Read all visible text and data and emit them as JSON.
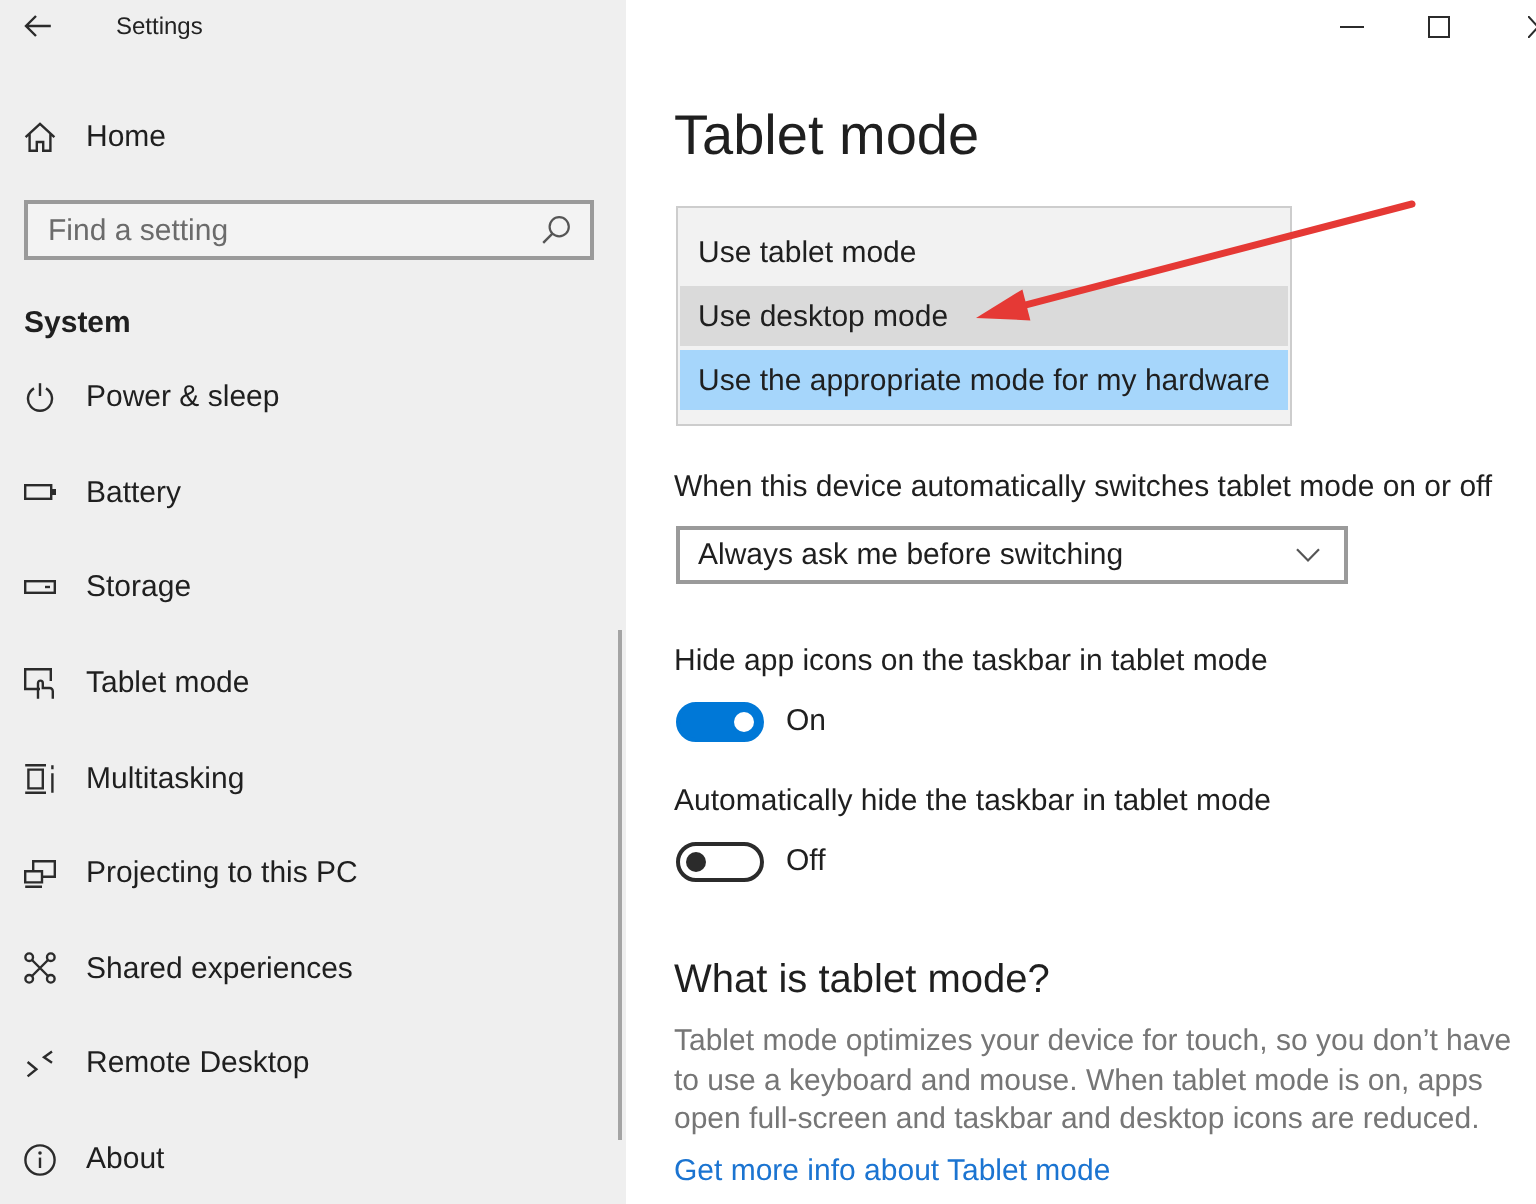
{
  "window": {
    "title": "Settings"
  },
  "sidebar": {
    "home": "Home",
    "search": {
      "placeholder": "Find a setting"
    },
    "section": "System",
    "items": [
      "Power & sleep",
      "Battery",
      "Storage",
      "Tablet mode",
      "Multitasking",
      "Projecting to this PC",
      "Shared experiences",
      "Remote Desktop",
      "About"
    ]
  },
  "page": {
    "title": "Tablet mode",
    "mode_options": [
      {
        "label": "Use tablet mode",
        "selected": false,
        "hovered": false
      },
      {
        "label": "Use desktop mode",
        "selected": false,
        "hovered": true
      },
      {
        "label": "Use the appropriate mode for my hardware",
        "selected": true,
        "hovered": false
      }
    ],
    "switch_setting": {
      "label": "When this device automatically switches tablet mode on or off",
      "value": "Always ask me before switching"
    },
    "toggles": [
      {
        "label": "Hide app icons on the taskbar in tablet mode",
        "on": true,
        "state_text": "On"
      },
      {
        "label": "Automatically hide the taskbar in tablet mode",
        "on": false,
        "state_text": "Off"
      }
    ],
    "about": {
      "heading": "What is tablet mode?",
      "text": "Tablet mode optimizes your device for touch, so you don’t have to use a keyboard and mouse. When tablet mode is on, apps open full-screen and taskbar and desktop icons are reduced.",
      "link": "Get more info about Tablet mode"
    }
  }
}
